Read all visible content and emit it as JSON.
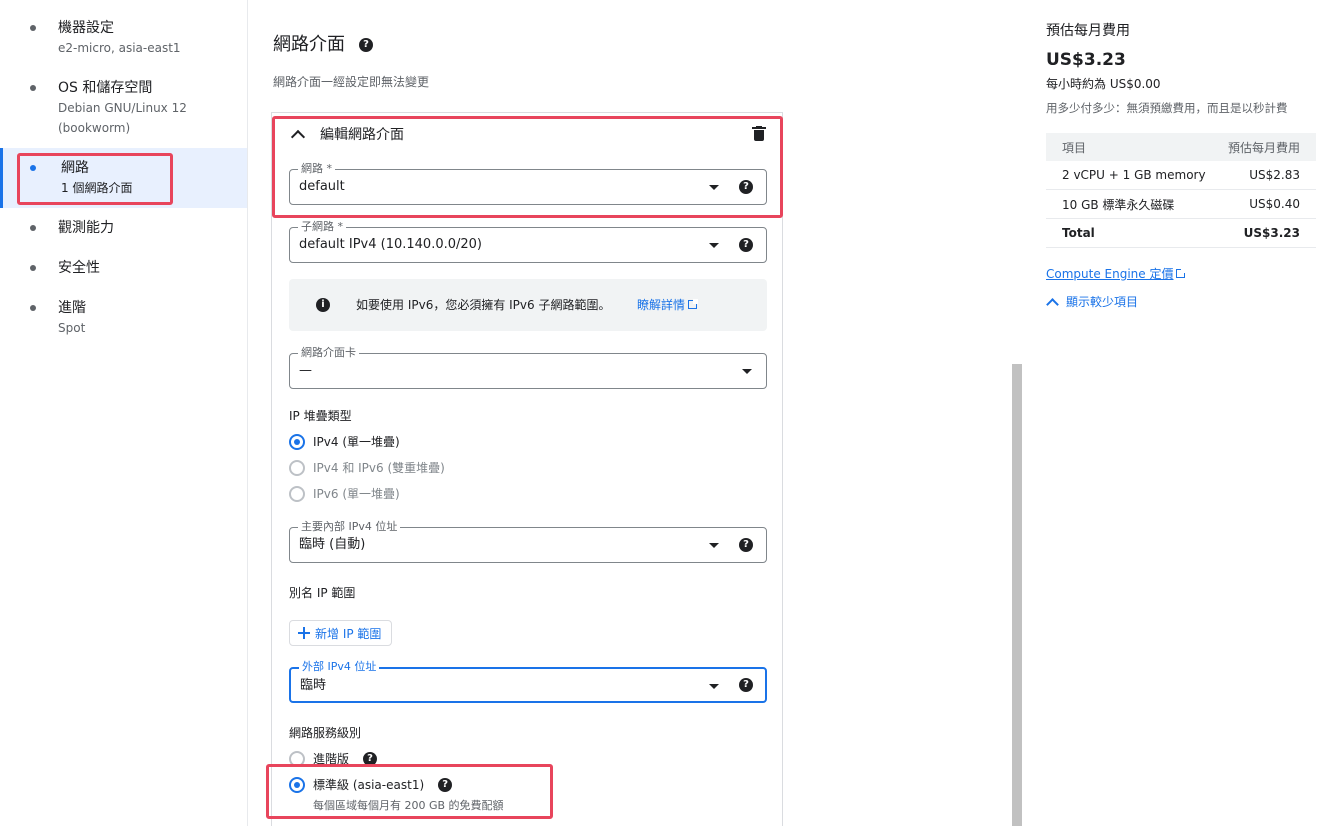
{
  "nav": {
    "steps": [
      {
        "title": "機器設定",
        "sub": "e2-micro, asia-east1"
      },
      {
        "title": "OS 和儲存空間",
        "sub": "Debian GNU/Linux 12",
        "sub2": "(bookworm)"
      },
      {
        "title": "網路",
        "sub": "1 個網路介面"
      },
      {
        "title": "觀測能力"
      },
      {
        "title": "安全性"
      },
      {
        "title": "進階",
        "sub": "Spot"
      }
    ]
  },
  "main": {
    "title": "網路介面",
    "subtitle": "網路介面一經設定即無法變更",
    "card_title": "編輯網路介面",
    "network": {
      "label": "網路 *",
      "value": "default"
    },
    "subnet": {
      "label": "子網路 *",
      "value": "default IPv4 (10.140.0.0/20)"
    },
    "info": {
      "message": "如要使用 IPv6，您必須擁有 IPv6 子網路範圍。",
      "link": "瞭解詳情"
    },
    "nic": {
      "label": "網路介面卡",
      "value": "—"
    },
    "stack": {
      "label": "IP 堆疊類型",
      "options": [
        "IPv4 (單一堆疊)",
        "IPv4 和 IPv6 (雙重堆疊)",
        "IPv6 (單一堆疊)"
      ]
    },
    "internal_ip": {
      "label": "主要內部 IPv4 位址",
      "value": "臨時 (自動)"
    },
    "alias": {
      "label": "別名 IP 範圍",
      "button": "新增 IP 範圍"
    },
    "external_ip": {
      "label": "外部 IPv4 位址",
      "value": "臨時"
    },
    "tier": {
      "label": "網路服務級別",
      "premium": "進階版",
      "standard": "標準級 (asia-east1)",
      "standard_note": "每個區域每個月有 200 GB 的免費配額"
    }
  },
  "cost": {
    "title": "預估每月費用",
    "amount": "US$3.23",
    "hourly": "每小時約為 US$0.00",
    "note": "用多少付多少：無須預繳費用，而且是以秒計費",
    "table": {
      "header": [
        "項目",
        "預估每月費用"
      ],
      "rows": [
        [
          "2 vCPU + 1 GB memory",
          "US$2.83"
        ],
        [
          "10 GB 標準永久磁碟",
          "US$0.40"
        ]
      ],
      "total": [
        "Total",
        "US$3.23"
      ]
    },
    "pricing_link": "Compute Engine 定價",
    "show_less": "顯示較少項目"
  },
  "colors": {
    "accent": "#1a73e8",
    "highlight": "#e8455c"
  }
}
